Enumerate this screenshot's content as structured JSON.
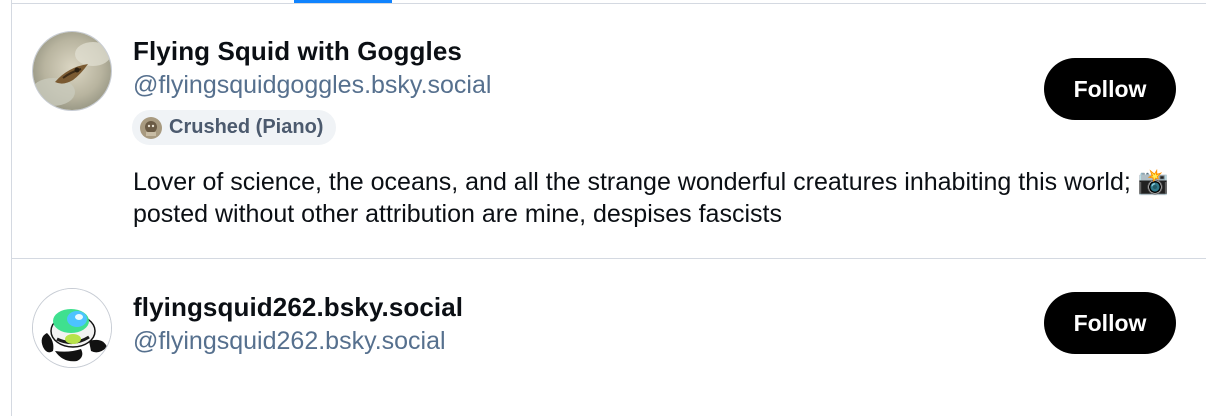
{
  "profiles": [
    {
      "display_name": "Flying Squid with Goggles",
      "handle": "@flyingsquidgoggles.bsky.social",
      "badge_label": "Crushed (Piano)",
      "bio_part1": "Lover of science, the oceans, and all the strange wonderful creatures inhabiting this world; ",
      "bio_emoji": "📸",
      "bio_part2": " posted without other attribution are mine, despises fascists",
      "follow_label": "Follow"
    },
    {
      "display_name": "flyingsquid262.bsky.social",
      "handle": "@flyingsquid262.bsky.social",
      "follow_label": "Follow"
    }
  ],
  "colors": {
    "tab_indicator": "#1083fe",
    "handle": "#56708e",
    "follow_button": "#000000",
    "divider": "#d4d9e1"
  }
}
